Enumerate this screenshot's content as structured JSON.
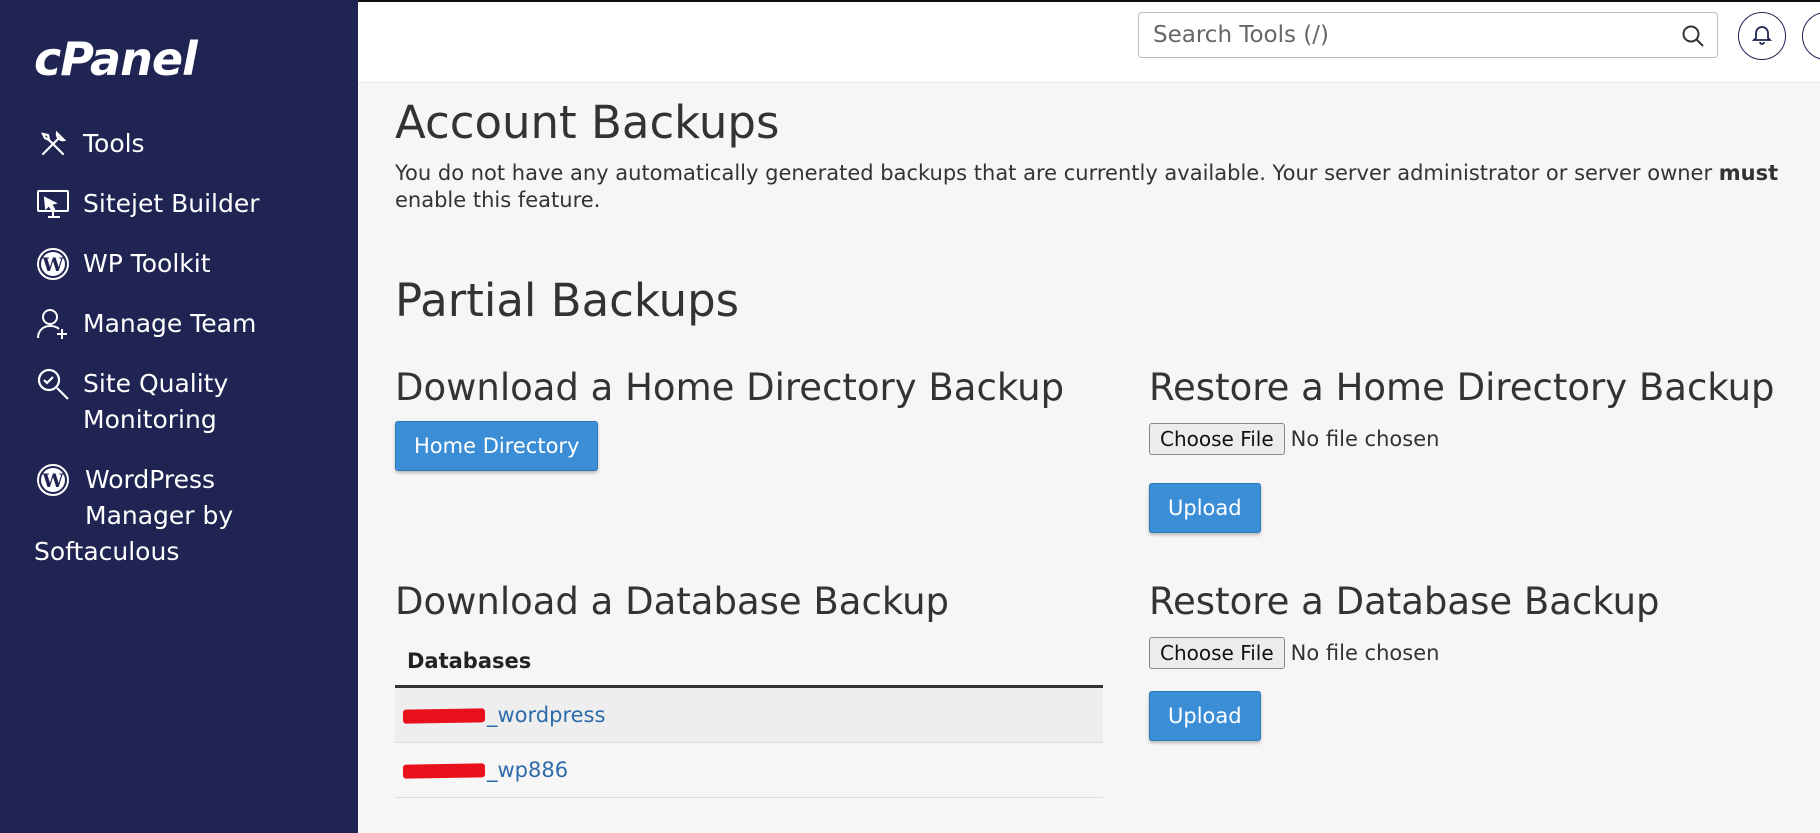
{
  "sidebar": {
    "logo": "cPanel",
    "items": [
      {
        "label": "Tools",
        "icon": "tools-icon"
      },
      {
        "label": "Sitejet Builder",
        "icon": "sitejet-monitor-icon"
      },
      {
        "label": "WP Toolkit",
        "icon": "wordpress-icon"
      },
      {
        "label": "Manage Team",
        "icon": "add-user-icon"
      },
      {
        "label_line1": "Site Quality",
        "label_line2": "Monitoring",
        "icon": "search-magnifier-icon"
      },
      {
        "label_line1": "WordPress",
        "label_line2": "Manager by",
        "label_line3": "Softaculous",
        "icon": "wordpress-icon"
      }
    ]
  },
  "topbar": {
    "search_placeholder": "Search Tools (/)",
    "search_icon": "search-icon",
    "bell_icon": "bell-icon",
    "user_icon": "user-icon"
  },
  "account_backups": {
    "title": "Account Backups",
    "desc_before": "You do not have any automatically generated backups that are currently available. Your server administrator or server owner ",
    "desc_bold": "must",
    "desc_after": " enable this feature."
  },
  "partial_backups": {
    "title": "Partial Backups",
    "download_home": {
      "title": "Download a Home Directory Backup",
      "button": "Home Directory"
    },
    "restore_home": {
      "title": "Restore a Home Directory Backup",
      "choose_file": "Choose File",
      "status": "No file chosen",
      "upload": "Upload"
    },
    "download_db": {
      "title": "Download a Database Backup",
      "column": "Databases",
      "rows": [
        {
          "suffix": "_wordpress"
        },
        {
          "suffix": "_wp886"
        }
      ]
    },
    "restore_db": {
      "title": "Restore a Database Backup",
      "choose_file": "Choose File",
      "status": "No file chosen",
      "upload": "Upload"
    }
  },
  "colors": {
    "sidebar_bg": "#1f2452",
    "primary_button": "#3b8ed6",
    "link": "#2d6bab",
    "redaction": "#e8101a"
  }
}
